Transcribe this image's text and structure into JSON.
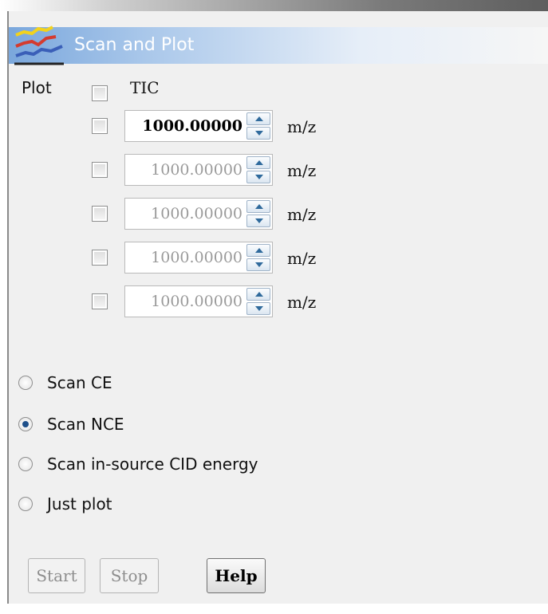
{
  "window": {
    "title": "Scan and Plot"
  },
  "plot": {
    "label": "Plot",
    "tic_label": "TIC",
    "tic_checked": false,
    "mass_rows": [
      {
        "value": "1000.00000",
        "unit": "m/z",
        "enabled": true,
        "checked": false
      },
      {
        "value": "1000.00000",
        "unit": "m/z",
        "enabled": false,
        "checked": false
      },
      {
        "value": "1000.00000",
        "unit": "m/z",
        "enabled": false,
        "checked": false
      },
      {
        "value": "1000.00000",
        "unit": "m/z",
        "enabled": false,
        "checked": false
      },
      {
        "value": "1000.00000",
        "unit": "m/z",
        "enabled": false,
        "checked": false
      }
    ]
  },
  "scan_mode": {
    "options": [
      {
        "label": "Scan CE",
        "selected": false
      },
      {
        "label": "Scan NCE",
        "selected": true
      },
      {
        "label": "Scan in-source CID energy",
        "selected": false
      },
      {
        "label": "Just plot",
        "selected": false
      }
    ]
  },
  "buttons": {
    "start": "Start",
    "stop": "Stop",
    "help": "Help"
  },
  "icons": {
    "title": "line-chart-icon"
  },
  "colors": {
    "title_bar": "#7aa7dc",
    "radio_selected": "#1e4f8a",
    "spin_arrow": "#2f6a9c"
  }
}
